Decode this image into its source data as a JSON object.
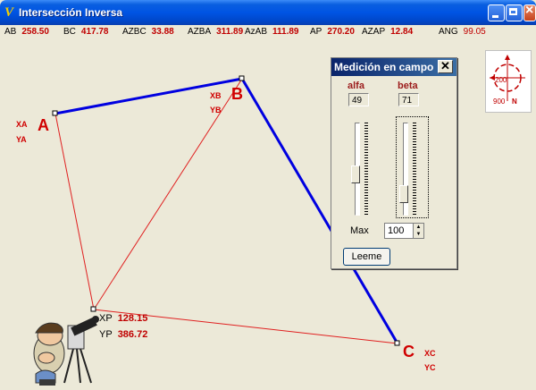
{
  "window": {
    "title": "Intersección Inversa",
    "icon": "app-logo-icon"
  },
  "stats": [
    {
      "label": "AB",
      "value": "258.50"
    },
    {
      "label": "BC",
      "value": "417.78"
    },
    {
      "label": "AZBC",
      "value": "33.88"
    },
    {
      "label": "AZBA",
      "value": "311.89"
    },
    {
      "label": "AzAB",
      "value": "111.89"
    },
    {
      "label": "AP",
      "value": "270.20"
    },
    {
      "label": "AZAP",
      "value": "12.84"
    },
    {
      "label": "ANG",
      "value": "99.05"
    }
  ],
  "points": {
    "A": {
      "name": "A",
      "x_label": "XA",
      "y_label": "YA"
    },
    "B": {
      "name": "B",
      "x_label": "XB",
      "y_label": "YB"
    },
    "C": {
      "name": "C",
      "x_label": "XC",
      "y_label": "YC"
    },
    "P": {
      "x_label": "XP",
      "x_value": "128.15",
      "y_label": "YP",
      "y_value": "386.72"
    }
  },
  "dialog": {
    "title": "Medición en campo",
    "alfa_label": "alfa",
    "alfa_value": "49",
    "beta_label": "beta",
    "beta_value": "71",
    "max_label": "Max",
    "max_value": "100",
    "button_label": "Leeme"
  },
  "compass": {
    "value_top": "200",
    "value_bottom": "900",
    "north": "N"
  },
  "colors": {
    "line_blue": "#0000e0",
    "line_red": "#e02020",
    "value_red": "#c00000"
  }
}
